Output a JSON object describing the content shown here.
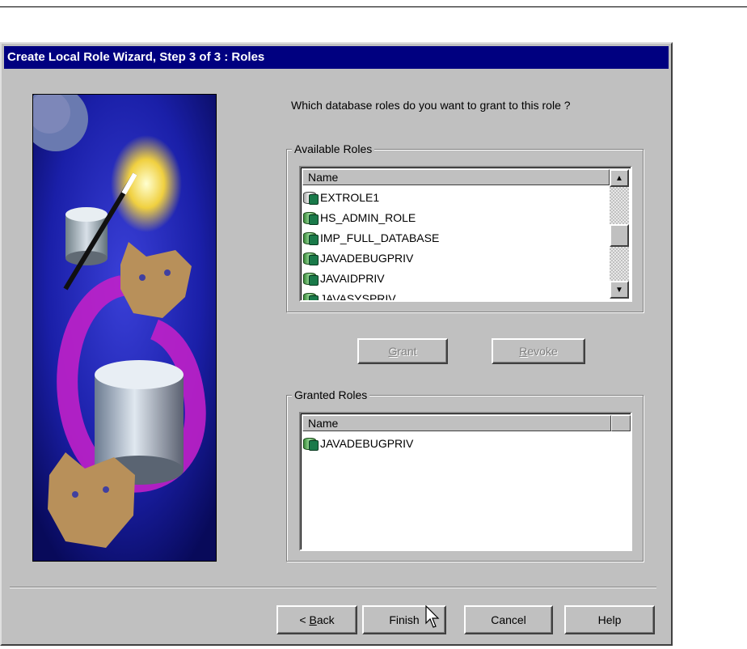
{
  "window": {
    "title": "Create Local Role Wizard, Step 3 of 3 : Roles"
  },
  "question": "Which database roles do you want to grant to this role ?",
  "available": {
    "legend": "Available Roles",
    "column": "Name",
    "items": [
      {
        "label": "EXTROLE1",
        "icon": "external-role-icon"
      },
      {
        "label": "HS_ADMIN_ROLE",
        "icon": "role-icon"
      },
      {
        "label": "IMP_FULL_DATABASE",
        "icon": "role-icon"
      },
      {
        "label": "JAVADEBUGPRIV",
        "icon": "role-icon"
      },
      {
        "label": "JAVAIDPRIV",
        "icon": "role-icon"
      },
      {
        "label": "JAVASYSPRIV",
        "icon": "role-icon"
      }
    ]
  },
  "actions": {
    "grant_pre": "",
    "grant_mn": "G",
    "grant_post": "rant",
    "revoke_pre": "",
    "revoke_mn": "R",
    "revoke_post": "evoke"
  },
  "granted": {
    "legend": "Granted Roles",
    "column": "Name",
    "items": [
      {
        "label": "JAVADEBUGPRIV",
        "icon": "role-icon"
      }
    ]
  },
  "footer": {
    "back_pre": "< ",
    "back_mn": "B",
    "back_post": "ack",
    "finish": "Finish",
    "cancel": "Cancel",
    "help": "Help"
  }
}
